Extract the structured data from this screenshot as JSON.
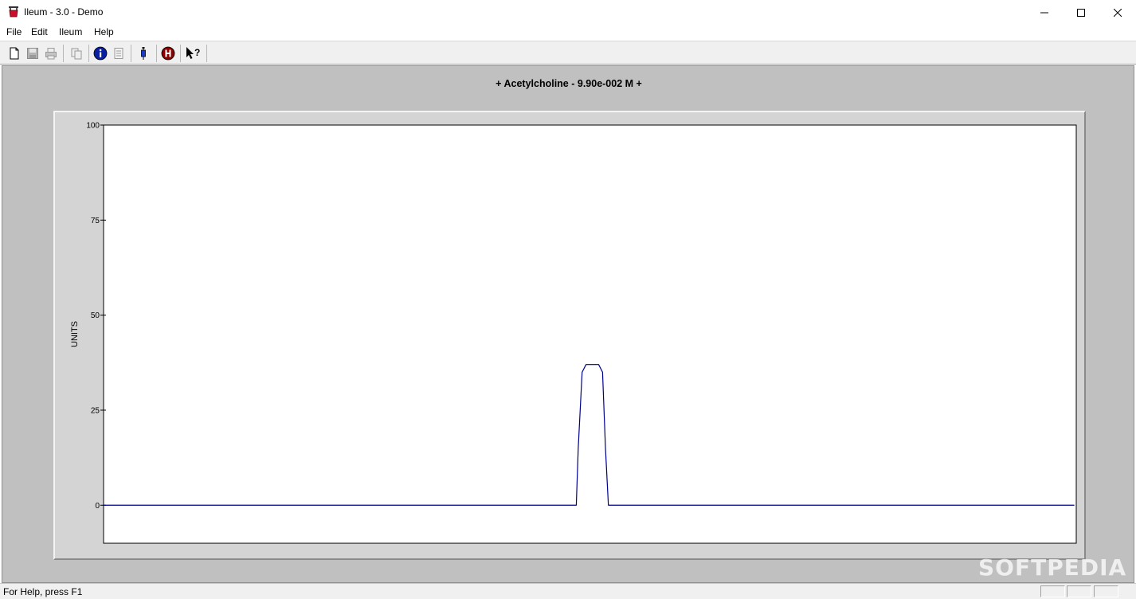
{
  "window": {
    "title": "Ileum - 3.0 - Demo",
    "app_icon": "ileum-app-icon",
    "controls": [
      "minimize-icon",
      "maximize-icon",
      "close-icon"
    ]
  },
  "menu": {
    "items": [
      "File",
      "Edit",
      "Ileum",
      "Help"
    ]
  },
  "toolbar": {
    "buttons": [
      {
        "icon": "new-document-icon",
        "enabled": true
      },
      {
        "icon": "save-icon",
        "enabled": false
      },
      {
        "icon": "print-icon",
        "enabled": false
      },
      {
        "icon": "copy-icon",
        "enabled": false
      },
      {
        "icon": "info-icon",
        "enabled": true
      },
      {
        "icon": "notes-icon",
        "enabled": false
      },
      {
        "icon": "syringe-icon",
        "enabled": true
      },
      {
        "icon": "h-icon",
        "enabled": true
      },
      {
        "icon": "context-help-icon",
        "enabled": true
      }
    ]
  },
  "chart_data": {
    "type": "line",
    "title": "+ Acetylcholine - 9.90e-002 M +",
    "xlabel": "",
    "ylabel": "UNITS",
    "ylim": [
      -10,
      100
    ],
    "xlim": [
      0,
      100
    ],
    "yticks": [
      0,
      25,
      50,
      75,
      100
    ],
    "grid": false,
    "series": [
      {
        "color": "#00008b",
        "x": [
          0,
          48.6,
          48.8,
          49.2,
          49.6,
          50.1,
          50.9,
          51.3,
          51.6,
          51.9,
          99.8
        ],
        "y": [
          0,
          0,
          15,
          35,
          37,
          37,
          37,
          35,
          15,
          0,
          0
        ]
      }
    ]
  },
  "status": {
    "text": "For Help, press F1"
  },
  "watermark": {
    "text": "SOFTPEDIA"
  },
  "colors": {
    "client_bg": "#c0c0c0",
    "trace": "#00008b"
  }
}
